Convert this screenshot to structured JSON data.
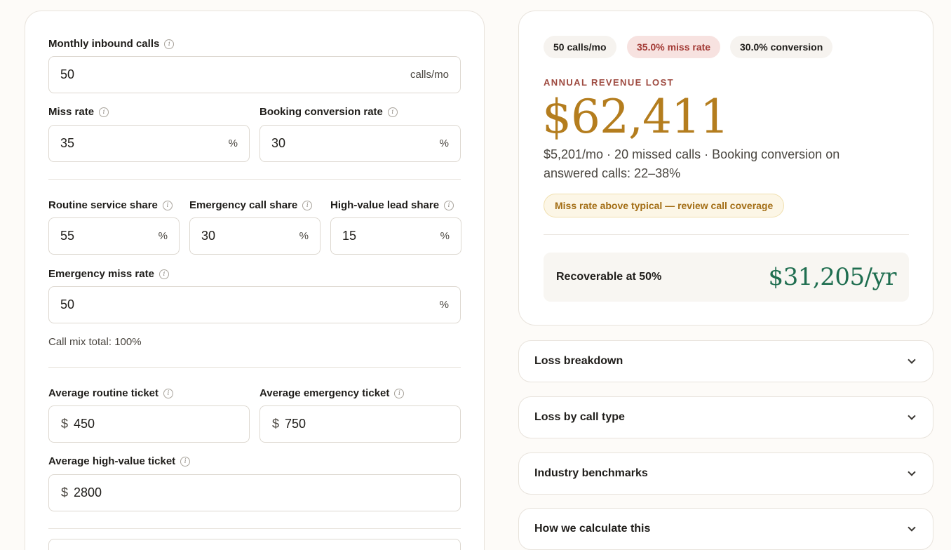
{
  "inputs": {
    "monthly_calls": {
      "label": "Monthly inbound calls",
      "value": "50",
      "suffix": "calls/mo"
    },
    "miss_rate": {
      "label": "Miss rate",
      "value": "35",
      "suffix": "%"
    },
    "booking_conversion": {
      "label": "Booking conversion rate",
      "value": "30",
      "suffix": "%"
    },
    "routine_share": {
      "label": "Routine service share",
      "value": "55",
      "suffix": "%"
    },
    "emergency_share": {
      "label": "Emergency call share",
      "value": "30",
      "suffix": "%"
    },
    "high_value_share": {
      "label": "High-value lead share",
      "value": "15",
      "suffix": "%"
    },
    "emergency_miss_rate": {
      "label": "Emergency miss rate",
      "value": "50",
      "suffix": "%"
    },
    "call_mix_total": "Call mix total: 100%",
    "avg_routine_ticket": {
      "label": "Average routine ticket",
      "prefix": "$",
      "value": "450"
    },
    "avg_emergency_ticket": {
      "label": "Average emergency ticket",
      "prefix": "$",
      "value": "750"
    },
    "avg_high_value_ticket": {
      "label": "Average high-value ticket",
      "prefix": "$",
      "value": "2800"
    }
  },
  "results": {
    "chips": [
      "50 calls/mo",
      "35.0% miss rate",
      "30.0% conversion"
    ],
    "kicker": "ANNUAL REVENUE LOST",
    "annual_loss": "$62,411",
    "subline": "$5,201/mo · 20 missed calls · Booking conversion on answered calls: 22–38%",
    "warning": "Miss rate above typical — review call coverage",
    "recover_label": "Recoverable at 50%",
    "recover_value": "$31,205/yr"
  },
  "accordions": [
    "Loss breakdown",
    "Loss by call type",
    "Industry benchmarks",
    "How we calculate this"
  ],
  "colors": {
    "accent_gold": "#b47d1e",
    "accent_green": "#1f6e50",
    "accent_red": "#a33a35"
  }
}
